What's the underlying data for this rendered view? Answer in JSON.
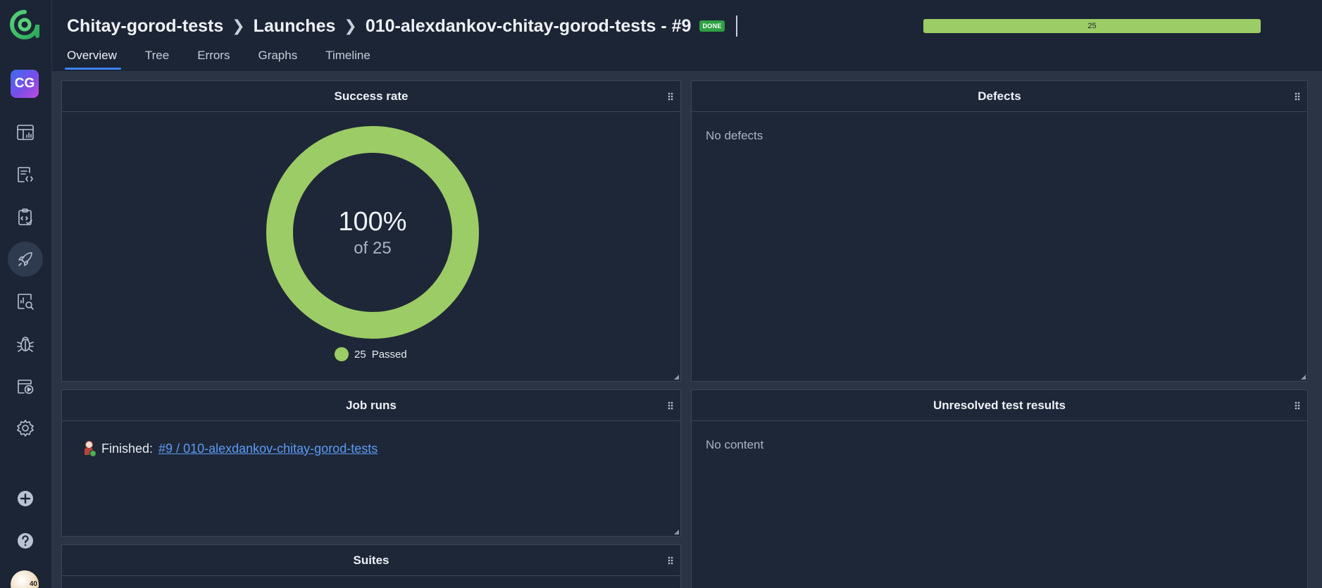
{
  "header": {
    "breadcrumb": {
      "project": "Chitay-gorod-tests",
      "section": "Launches",
      "launch": "010-alexdankov-chitay-gorod-tests - #9"
    },
    "status_badge": "DONE",
    "progress_value": "25",
    "progress_fraction": 1.0
  },
  "sidebar": {
    "project_initials": "CG",
    "avatar_label": "40",
    "items": [
      {
        "icon": "dashboard-icon"
      },
      {
        "icon": "test-cases-icon"
      },
      {
        "icon": "test-plans-icon"
      },
      {
        "icon": "launches-icon",
        "active": true
      },
      {
        "icon": "analytics-icon"
      },
      {
        "icon": "defects-icon"
      },
      {
        "icon": "jobs-icon"
      },
      {
        "icon": "settings-icon"
      },
      {
        "icon": "add-icon"
      },
      {
        "icon": "help-icon"
      }
    ]
  },
  "tabs": [
    {
      "label": "Overview",
      "active": true
    },
    {
      "label": "Tree"
    },
    {
      "label": "Errors"
    },
    {
      "label": "Graphs"
    },
    {
      "label": "Timeline"
    }
  ],
  "widgets": {
    "success_rate": {
      "title": "Success rate",
      "percent": "100%",
      "of_label": "of 25",
      "legend_count": "25",
      "legend_label": "Passed",
      "color": "#9ccc65"
    },
    "defects": {
      "title": "Defects",
      "empty_text": "No defects"
    },
    "job_runs": {
      "title": "Job runs",
      "status_text": "Finished:",
      "link_text": "#9 / 010-alexdankov-chitay-gorod-tests"
    },
    "unresolved": {
      "title": "Unresolved test results",
      "empty_text": "No content"
    },
    "suites": {
      "title": "Suites"
    }
  },
  "colors": {
    "accent": "#3b82f6",
    "passed": "#9ccc65",
    "background": "#1a2332"
  }
}
